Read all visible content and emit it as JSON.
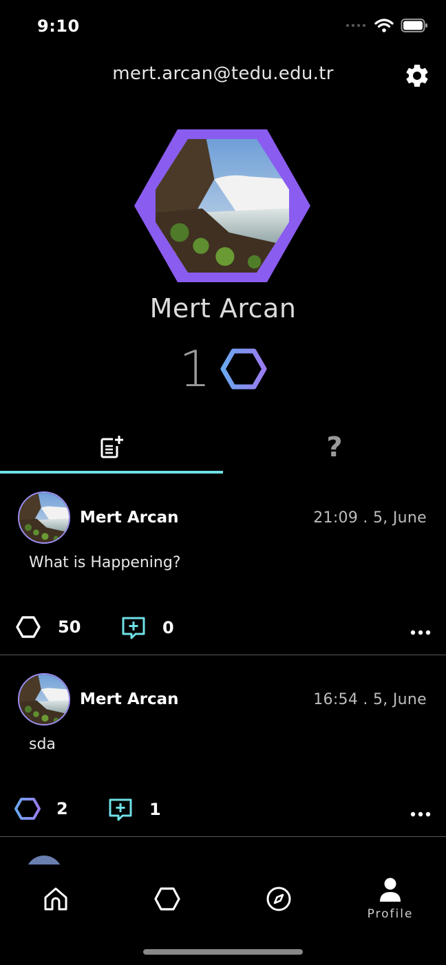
{
  "status_bar": {
    "time": "9:10"
  },
  "header": {
    "email": "mert.arcan@tedu.edu.tr"
  },
  "profile": {
    "name": "Mert Arcan",
    "honey_count": "1"
  },
  "tabs": [
    {
      "id": "posts",
      "icon": "add-post-icon",
      "selected": true
    },
    {
      "id": "questions",
      "label": "?",
      "selected": false
    }
  ],
  "posts": [
    {
      "author": "Mert Arcan",
      "time": "21:09 . 5, June",
      "text": "What is Happening?",
      "honey_count": "50",
      "comment_count": "0",
      "honey_given": false
    },
    {
      "author": "Mert Arcan",
      "time": "16:54 . 5, June",
      "text": "sda",
      "honey_count": "2",
      "comment_count": "1",
      "honey_given": true
    }
  ],
  "bottom_nav": [
    {
      "id": "home",
      "icon": "home-icon"
    },
    {
      "id": "honey",
      "icon": "hexagon-icon"
    },
    {
      "id": "explore",
      "icon": "compass-icon"
    },
    {
      "id": "profile",
      "icon": "profile-icon",
      "label": "Profile",
      "selected": true
    }
  ],
  "colors": {
    "accent_purple": "#8a5cf0",
    "accent_cyan": "#6fe0e6",
    "background": "#000000"
  }
}
